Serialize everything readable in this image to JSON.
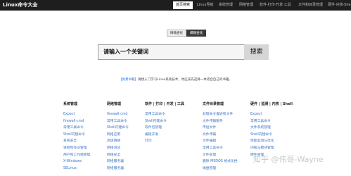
{
  "header": {
    "logo": "Linux命令大全",
    "tabs": [
      {
        "label": "首页搜索",
        "active": true
      },
      {
        "label": "Linux导航",
        "active": false
      },
      {
        "label": "系统管理",
        "active": false
      },
      {
        "label": "网络管理",
        "active": false
      },
      {
        "label": "软件·打印·开发·工具",
        "active": false
      },
      {
        "label": "文件和目录管理",
        "active": false
      },
      {
        "label": "硬件·内核·Shell",
        "active": false
      }
    ]
  },
  "search": {
    "modes": [
      "精确查找",
      "模糊查找"
    ],
    "selected_mode": "模糊查找",
    "placeholder": "请输入一个关键词",
    "button_label": "搜索"
  },
  "notice": {
    "tag": "【免费书籍】",
    "text": "要想入门学习Linux系统技术，你应该先选择一本适合自己的书籍。"
  },
  "columns": [
    {
      "title": "系统管理",
      "links": [
        "Expect",
        "firewall-cmd",
        "常用工具命令",
        "Shell内建命令",
        "系统安全",
        "进程和作业管理",
        "用户和工作组管理",
        "X-Windows",
        "SELinux"
      ]
    },
    {
      "title": "网络管理",
      "links": [
        "firewall-cmd",
        "常用工具命令",
        "Shell内建命令",
        "网络应用",
        "高级网络",
        "网络测试",
        "网络安全",
        "网络服务器",
        "网络服务器"
      ]
    },
    {
      "title": "软件 | 打印 | 开发 | 工具",
      "links": [
        "常用工具命令",
        "Shell内建命令",
        "软件包管理",
        "编程开发",
        "打印"
      ]
    },
    {
      "title": "文件目录管理",
      "links": [
        "处理命令描述和文件",
        "文件传输服务",
        "传送文件",
        "文件传输",
        "文件编辑",
        "常用工具命令",
        "文件处理",
        "删除 MSDOS 格式化档",
        "磁盘管理"
      ]
    },
    {
      "title": "硬件 | 监测 | 内核 | Shell",
      "links": [
        "Expect",
        "常用工具命令",
        "文件系统管理",
        "Shell内建命令",
        "性能监测与优化",
        "内核与模块管理",
        "硬件管理"
      ]
    }
  ],
  "watermark": "知乎 @伟哥-Wayne"
}
